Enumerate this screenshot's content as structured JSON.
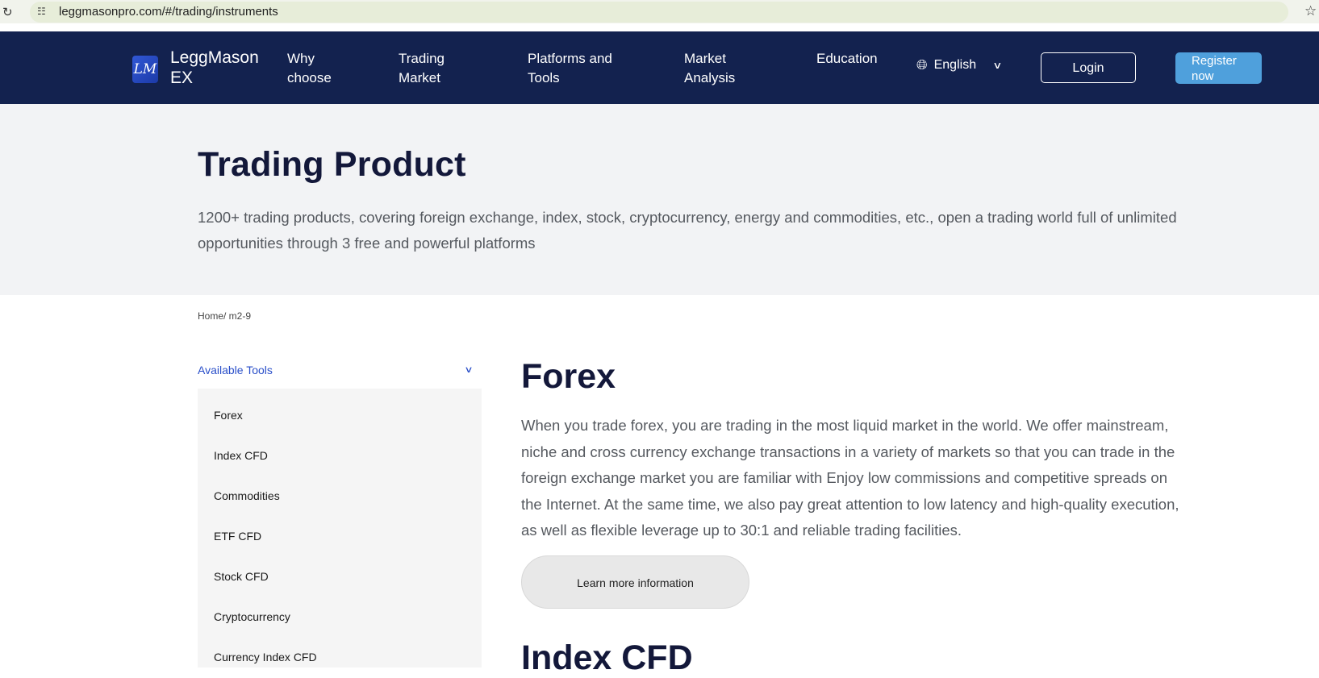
{
  "browser": {
    "url": "leggmasonpro.com/#/trading/instruments"
  },
  "header": {
    "logo_text": "LM",
    "brand_line1": "LeggMason",
    "brand_line2": "EX",
    "nav": [
      {
        "line1": "Why",
        "line2": "choose"
      },
      {
        "line1": "Trading",
        "line2": "Market"
      },
      {
        "line1": "Platforms and",
        "line2": "Tools"
      },
      {
        "line1": "Market",
        "line2": "Analysis"
      },
      {
        "line1": "Education",
        "line2": ""
      }
    ],
    "language": "English",
    "login_label": "Login",
    "register_line1": "Register",
    "register_line2": "now"
  },
  "hero": {
    "title": "Trading Product",
    "description": "1200+ trading products, covering foreign exchange, index, stock, cryptocurrency, energy and commodities, etc., open a trading world full of unlimited opportunities through 3 free and powerful platforms"
  },
  "breadcrumb": "Home/ m2-9",
  "sidebar": {
    "heading": "Available Tools",
    "items": [
      "Forex",
      "Index CFD",
      "Commodities",
      "ETF CFD",
      "Stock CFD",
      "Cryptocurrency",
      "Currency Index CFD"
    ]
  },
  "main": {
    "title": "Forex",
    "description": "When you trade forex, you are trading in the most liquid market in the world. We offer mainstream, niche and cross currency exchange transactions in a variety of markets so that you can trade in the foreign exchange market you are familiar with Enjoy low commissions and competitive spreads on the Internet. At the same time, we also pay great attention to low latency and high-quality execution, as well as flexible leverage up to 30:1 and reliable trading facilities.",
    "button_label": "Learn more information",
    "next_title": "Index CFD"
  },
  "colors": {
    "header_bg": "#13224f",
    "register_bg": "#4fa0dc",
    "accent_link": "#2a4fc9",
    "hero_bg": "#f2f3f5"
  },
  "icons": [
    "reload-icon",
    "site-info-icon",
    "bookmark-star-icon",
    "globe-icon",
    "chevron-down-icon"
  ]
}
